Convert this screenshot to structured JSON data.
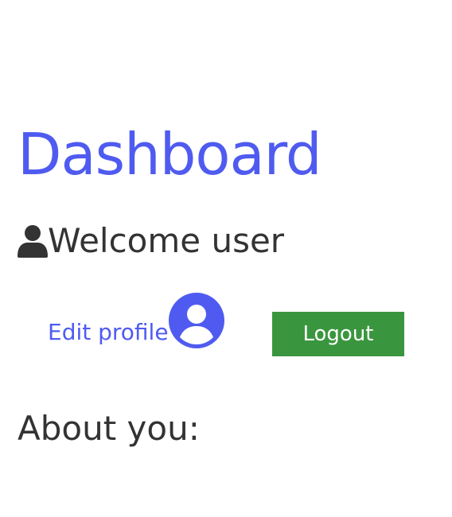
{
  "header": {
    "title": "Dashboard"
  },
  "welcome": {
    "icon": "user-icon",
    "text": "Welcome user"
  },
  "actions": {
    "edit_profile_label": "Edit profile",
    "profile_icon": "user-circle-icon",
    "logout_label": "Logout"
  },
  "about": {
    "heading": "About you:"
  },
  "colors": {
    "accent": "#4f5bf0",
    "logout_button": "#3a963e",
    "text": "#333333",
    "background": "#ffffff"
  }
}
